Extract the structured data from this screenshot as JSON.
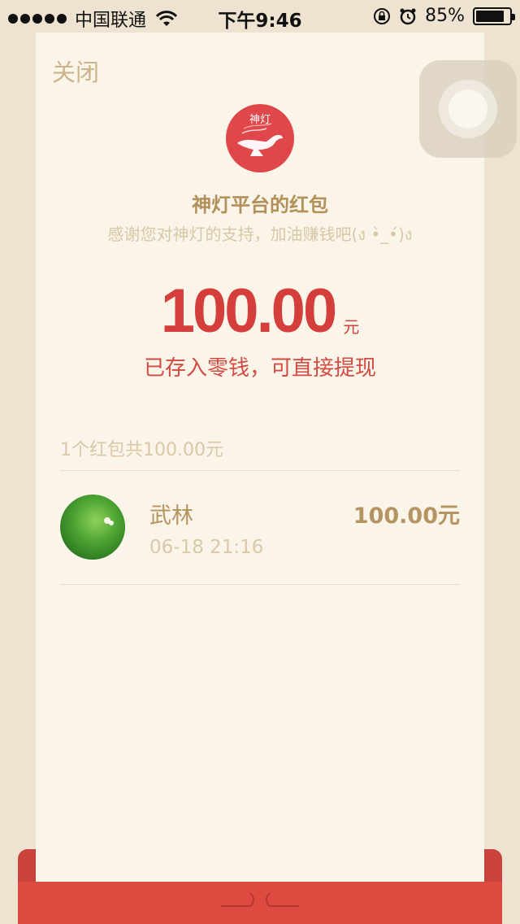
{
  "status_bar": {
    "carrier": "中国联通",
    "time": "下午9:46",
    "battery": "85%",
    "battery_level": 0.85,
    "icons": [
      "signal-dots",
      "wifi-icon",
      "rotation-lock-icon",
      "alarm-icon",
      "battery-icon"
    ]
  },
  "card": {
    "close_label": "关闭",
    "logo_text": "神灯",
    "sender_name": "神灯平台的红包",
    "wish": "感谢您对神灯的支持，加油赚钱吧(ง •̀_•́)ง",
    "amount": "100.00",
    "unit": "元",
    "stored_text": "已存入零钱，可直接提现",
    "summary": "1个红包共100.00元",
    "records": [
      {
        "name": "武林",
        "time": "06-18 21:16",
        "amount": "100.00元"
      }
    ]
  },
  "colors": {
    "background": "#ede3d0",
    "card": "#fbf4e8",
    "accent_red": "#d43f3c",
    "gold_text": "#b2905a",
    "muted_text": "#d6c7a6",
    "envelope_red": "#dc4a40"
  }
}
